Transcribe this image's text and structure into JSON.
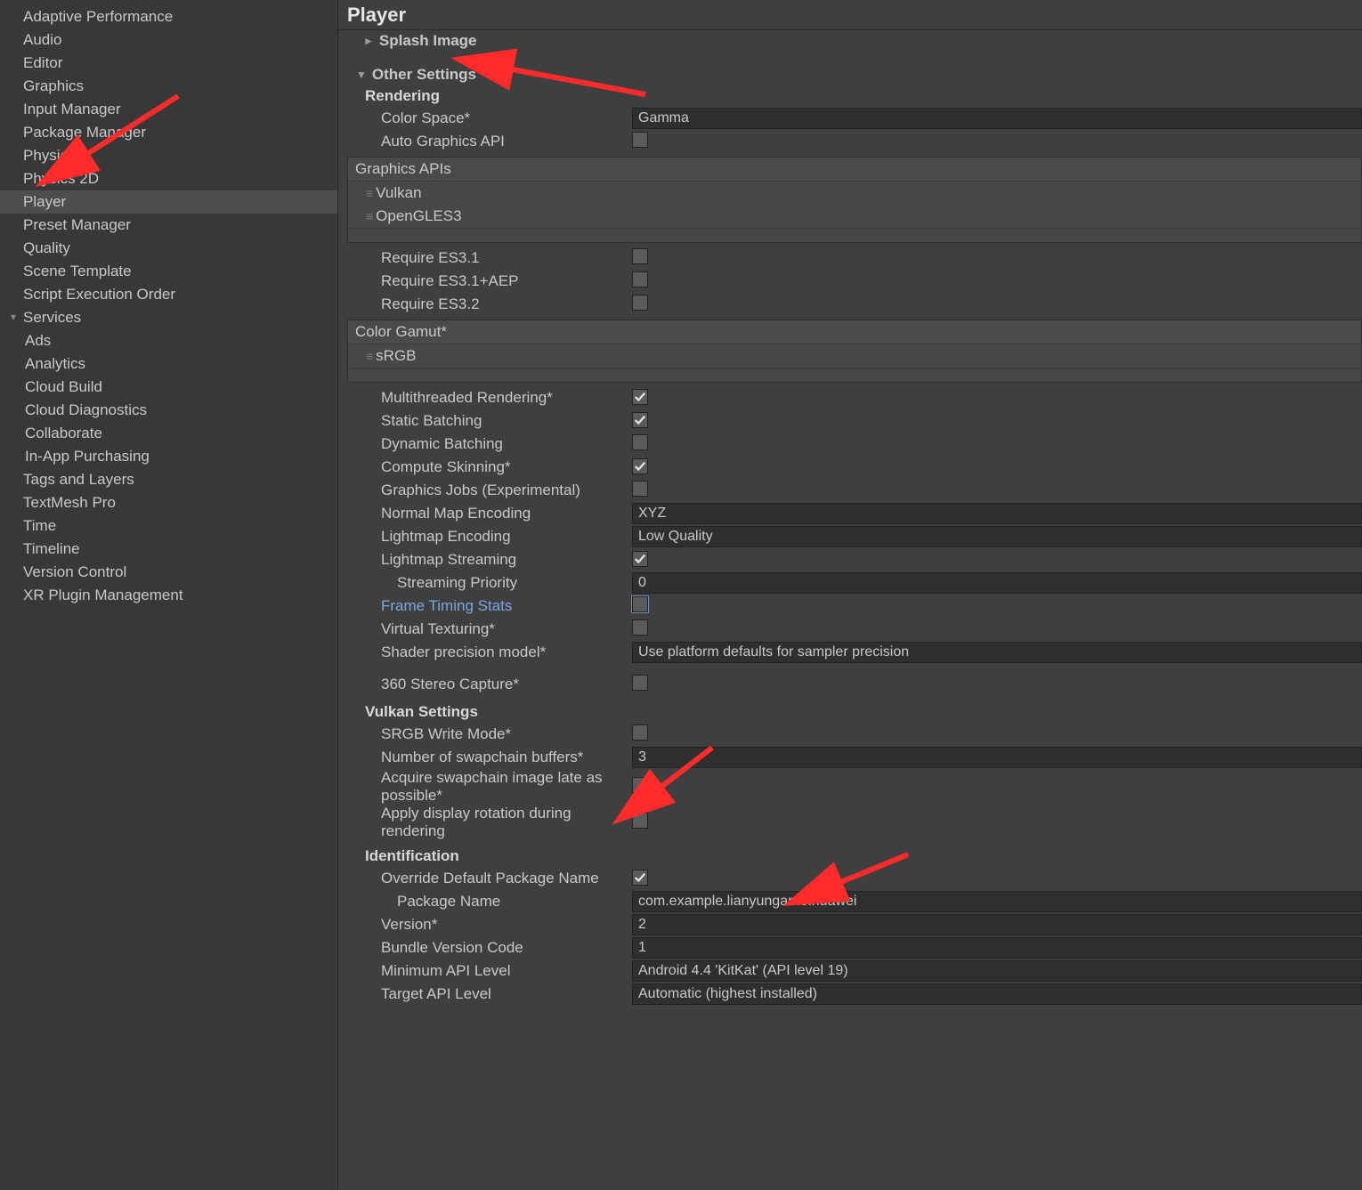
{
  "sidebar": {
    "items": [
      {
        "label": "Adaptive Performance",
        "indent": 0
      },
      {
        "label": "Audio",
        "indent": 0
      },
      {
        "label": "Editor",
        "indent": 0
      },
      {
        "label": "Graphics",
        "indent": 0
      },
      {
        "label": "Input Manager",
        "indent": 0
      },
      {
        "label": "Package Manager",
        "indent": 0
      },
      {
        "label": "Physics",
        "indent": 0
      },
      {
        "label": "Physics 2D",
        "indent": 0
      },
      {
        "label": "Player",
        "indent": 0,
        "selected": true
      },
      {
        "label": "Preset Manager",
        "indent": 0
      },
      {
        "label": "Quality",
        "indent": 0
      },
      {
        "label": "Scene Template",
        "indent": 0
      },
      {
        "label": "Script Execution Order",
        "indent": 0
      },
      {
        "label": "Services",
        "indent": 0,
        "expandable": true
      },
      {
        "label": "Ads",
        "indent": 1
      },
      {
        "label": "Analytics",
        "indent": 1
      },
      {
        "label": "Cloud Build",
        "indent": 1
      },
      {
        "label": "Cloud Diagnostics",
        "indent": 1
      },
      {
        "label": "Collaborate",
        "indent": 1
      },
      {
        "label": "In-App Purchasing",
        "indent": 1
      },
      {
        "label": "Tags and Layers",
        "indent": 0
      },
      {
        "label": "TextMesh Pro",
        "indent": 0
      },
      {
        "label": "Time",
        "indent": 0
      },
      {
        "label": "Timeline",
        "indent": 0
      },
      {
        "label": "Version Control",
        "indent": 0
      },
      {
        "label": "XR Plugin Management",
        "indent": 0
      }
    ]
  },
  "header": {
    "title": "Player"
  },
  "splash": {
    "title": "Splash Image",
    "tri": "►"
  },
  "other": {
    "title": "Other Settings",
    "tri": "▼",
    "rendering": {
      "title": "Rendering",
      "color_space_label": "Color Space*",
      "color_space_value": "Gamma",
      "auto_graphics_api_label": "Auto Graphics API",
      "auto_graphics_api": false,
      "graphics_apis_title": "Graphics APIs",
      "graphics_apis": [
        "Vulkan",
        "OpenGLES3"
      ],
      "require_es31_label": "Require ES3.1",
      "require_es31": false,
      "require_es31aep_label": "Require ES3.1+AEP",
      "require_es31aep": false,
      "require_es32_label": "Require ES3.2",
      "require_es32": false,
      "color_gamut_title": "Color Gamut*",
      "color_gamut_items": [
        "sRGB"
      ],
      "multithreaded_label": "Multithreaded Rendering*",
      "multithreaded": true,
      "static_batching_label": "Static Batching",
      "static_batching": true,
      "dynamic_batching_label": "Dynamic Batching",
      "dynamic_batching": false,
      "compute_skinning_label": "Compute Skinning*",
      "compute_skinning": true,
      "graphics_jobs_label": "Graphics Jobs (Experimental)",
      "graphics_jobs": false,
      "normal_map_label": "Normal Map Encoding",
      "normal_map_value": "XYZ",
      "lightmap_label": "Lightmap Encoding",
      "lightmap_value": "Low Quality",
      "lightmap_streaming_label": "Lightmap Streaming",
      "lightmap_streaming": true,
      "streaming_priority_label": "Streaming Priority",
      "streaming_priority_value": "0",
      "frame_timing_label": "Frame Timing Stats",
      "frame_timing": false,
      "virtual_texturing_label": "Virtual Texturing*",
      "virtual_texturing": false,
      "shader_precision_label": "Shader precision model*",
      "shader_precision_value": "Use platform defaults for sampler precision",
      "stereo_360_label": "360 Stereo Capture*",
      "stereo_360": false
    },
    "vulkan": {
      "title": "Vulkan Settings",
      "srgb_write_label": "SRGB Write Mode*",
      "srgb_write": false,
      "swapchain_buffers_label": "Number of swapchain buffers*",
      "swapchain_buffers_value": "3",
      "acquire_late_label": "Acquire swapchain image late as possible*",
      "acquire_late": false,
      "display_rotation_label": "Apply display rotation during rendering",
      "display_rotation": false
    },
    "identification": {
      "title": "Identification",
      "override_pkg_label": "Override Default Package Name",
      "override_pkg": true,
      "package_name_label": "Package Name",
      "package_name_value": "com.example.lianyungame.huawei",
      "version_label": "Version*",
      "version_value": "2",
      "bundle_code_label": "Bundle Version Code",
      "bundle_code_value": "1",
      "min_api_label": "Minimum API Level",
      "min_api_value": "Android 4.4 'KitKat' (API level 19)",
      "target_api_label": "Target API Level",
      "target_api_value": "Automatic (highest installed)"
    }
  }
}
